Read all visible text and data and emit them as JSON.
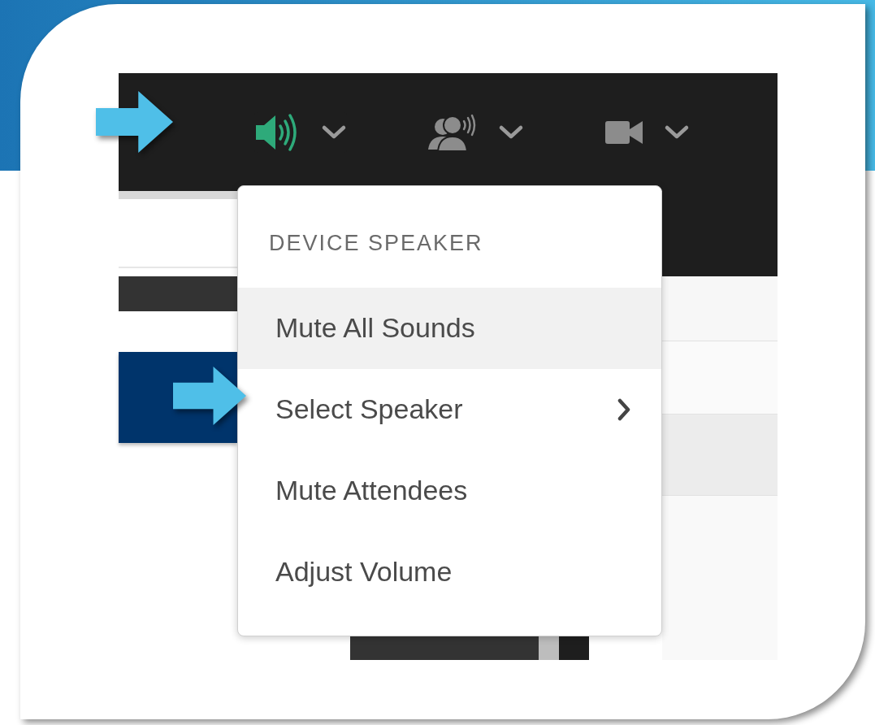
{
  "toolbar": {
    "buttons": [
      {
        "kind": "speaker",
        "selected": true
      },
      {
        "kind": "participants",
        "selected": false
      },
      {
        "kind": "camera",
        "selected": false
      }
    ]
  },
  "menu": {
    "heading": "DEVICE SPEAKER",
    "items": [
      {
        "label": "Mute All Sounds",
        "highlighted": true,
        "submenu": false
      },
      {
        "label": "Select Speaker",
        "highlighted": false,
        "submenu": true
      },
      {
        "label": "Mute Attendees",
        "highlighted": false,
        "submenu": false
      },
      {
        "label": "Adjust Volume",
        "highlighted": false,
        "submenu": false
      }
    ]
  }
}
